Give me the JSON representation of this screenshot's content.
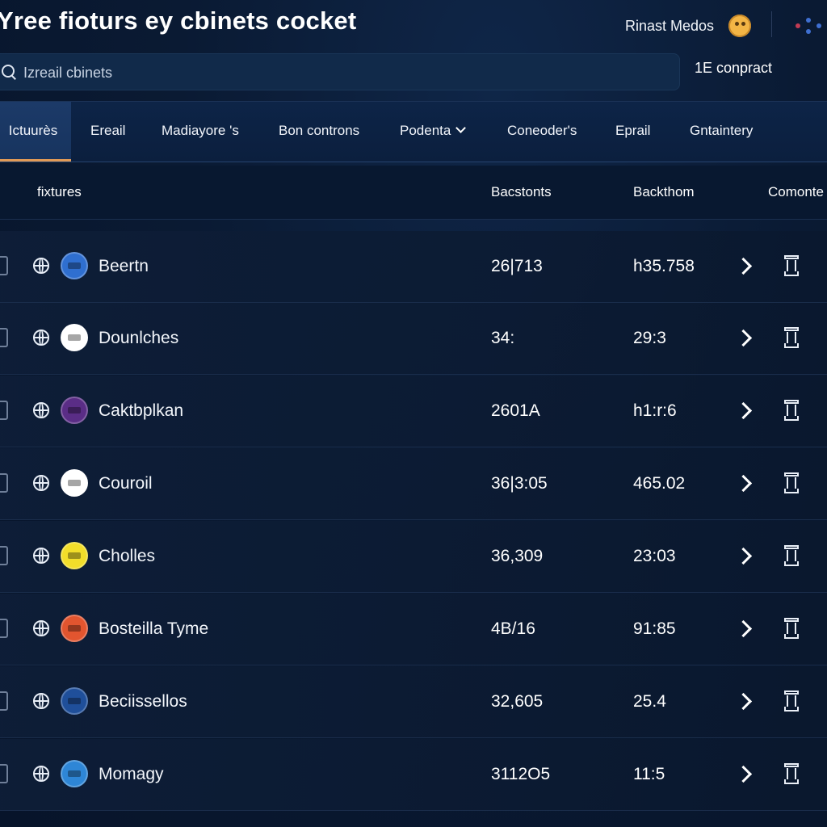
{
  "header": {
    "title": "Yree fioturs ey cbinets cocket",
    "user_name": "Rinast Medos",
    "avatar_color": "#f3b545",
    "menu_icon": "dots-menu-icon"
  },
  "search": {
    "placeholder": "Izreail cbinets"
  },
  "contract": {
    "label": "1E conpract"
  },
  "nav": {
    "items": [
      {
        "label": "Ictuurès",
        "active": true
      },
      {
        "label": "Ereail"
      },
      {
        "label": "Madiayore 's"
      },
      {
        "label": "Bon controns"
      },
      {
        "label": "Podenta",
        "dropdown": true
      },
      {
        "label": "Coneoder's"
      },
      {
        "label": "Eprail"
      },
      {
        "label": "Gntaintery"
      }
    ]
  },
  "table": {
    "headers": {
      "name": "fixtures",
      "col1": "Bacstonts",
      "col2": "Backthom",
      "col3": "Comonte"
    },
    "rows": [
      {
        "name": "Beertn",
        "col1": "26|713",
        "col2": "h35.758",
        "logo_color": "#2f6fd0"
      },
      {
        "name": "Dounlches",
        "col1": "34:",
        "col2": "29:3",
        "logo_color": "#ffffff"
      },
      {
        "name": "Caktbplkan",
        "col1": "2601A",
        "col2": "h1:r:6",
        "logo_color": "#5a2d86"
      },
      {
        "name": "Couroil",
        "col1": "36|3:05",
        "col2": "465.02",
        "logo_color": "#ffffff"
      },
      {
        "name": "Cholles",
        "col1": "36,309",
        "col2": "23:03",
        "logo_color": "#f2de2a"
      },
      {
        "name": "Bosteilla Tyme",
        "col1": "4B/16",
        "col2": "91:85",
        "logo_color": "#e2552f"
      },
      {
        "name": "Beciissellos",
        "col1": "32,605",
        "col2": "25.4",
        "logo_color": "#1f4f9a"
      },
      {
        "name": "Momagy",
        "col1": "3112O5",
        "col2": "11:5",
        "logo_color": "#2e86d6"
      }
    ]
  },
  "colors": {
    "accent": "#e19a57",
    "background": "#0a1a33",
    "nav_active": "#17345f"
  }
}
